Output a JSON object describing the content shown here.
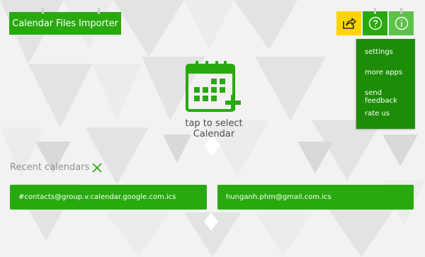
{
  "app": {
    "title": "Calendar Files Importer"
  },
  "toolbar": {
    "icons": [
      "share-icon",
      "help-icon",
      "info-icon"
    ]
  },
  "menu": {
    "items": [
      "settings",
      "more apps",
      "send feedback",
      "rate us"
    ]
  },
  "hero": {
    "caption": "tap to select Calendar",
    "icon": "calendar-add-icon"
  },
  "recent": {
    "title": "Recent calendars",
    "items": [
      "#contacts@group.v.calendar.google.com.ics",
      "hunganh.phm@gmail.com.ics"
    ]
  },
  "colors": {
    "accent": "#28a90e",
    "menu": "#1d8d08",
    "share_tile": "#ffd500",
    "info_tile": "#5ec24a"
  }
}
